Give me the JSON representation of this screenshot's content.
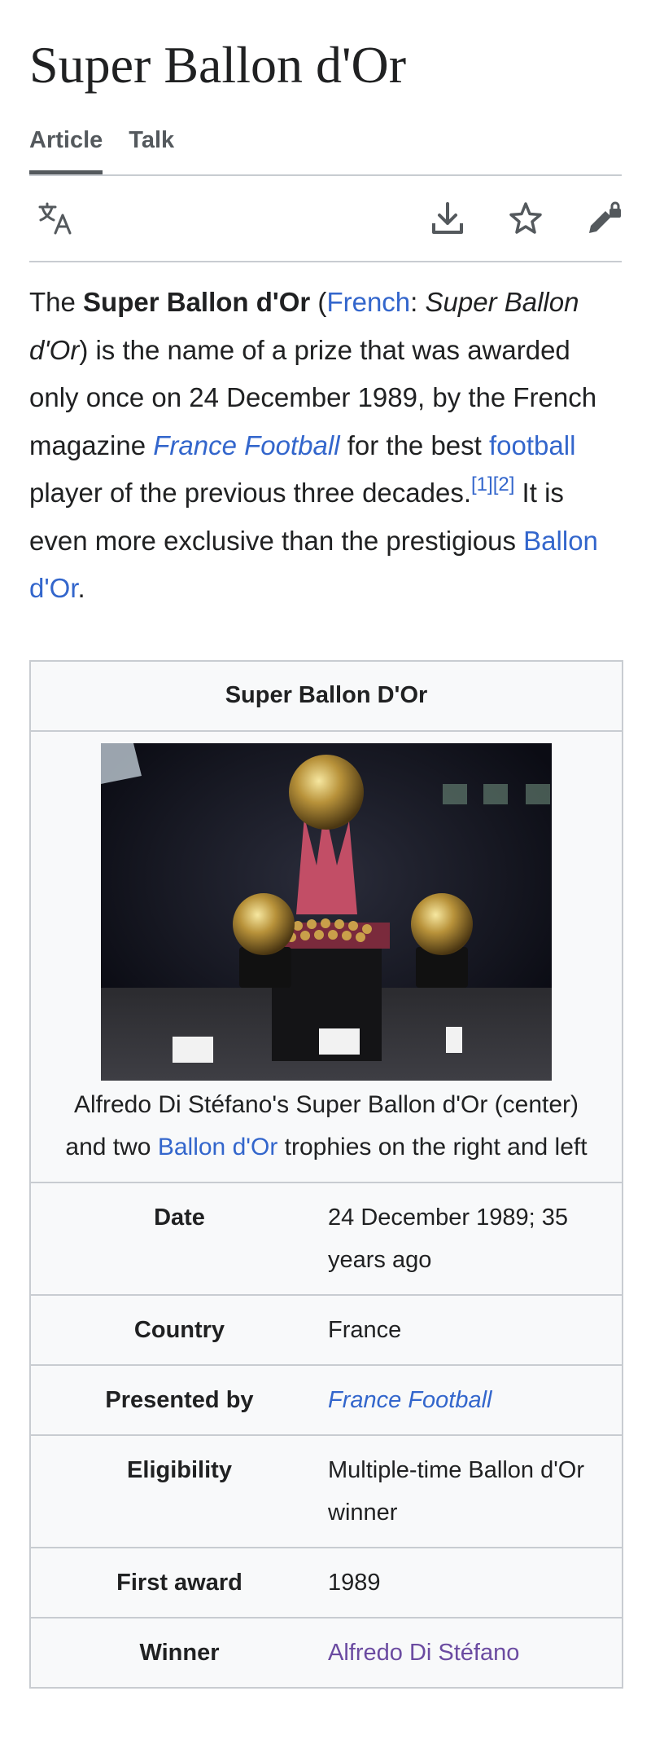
{
  "article": {
    "title": "Super Ballon d'Or",
    "tabs": [
      {
        "label": "Article",
        "active": true
      },
      {
        "label": "Talk",
        "active": false
      }
    ]
  },
  "toolbar": {
    "icons": [
      "translate-icon",
      "download-icon",
      "star-icon",
      "edit-lock-icon"
    ]
  },
  "intro": {
    "p1": "The ",
    "bold_name": "Super Ballon d'Or",
    "p2": " (",
    "lang_link": "French",
    "p3": ": ",
    "italic_name": "Super Ballon d'Or",
    "p4": ") is the name of a prize that was awarded only once on 24 December 1989, by the French magazine ",
    "magazine_link": "France Football",
    "p5": " for the best ",
    "football_link": "football",
    "p6": " player of the previous three decades.",
    "ref1": "[1]",
    "ref2": "[2]",
    "p7": " It is even more exclusive than the prestigious ",
    "ballon_link": "Ballon d'Or",
    "p8": "."
  },
  "infobox": {
    "heading": "Super Ballon D'Or",
    "caption_part1": "Alfredo Di Stéfano's Super Ballon d'Or (center) and two ",
    "caption_link": "Ballon d'Or",
    "caption_part2": " trophies on the right and left",
    "rows": [
      {
        "label": "Date",
        "value": "24 December 1989; 35 years ago"
      },
      {
        "label": "Country",
        "value": "France"
      },
      {
        "label": "Presented by",
        "value": "France Football"
      },
      {
        "label": "Eligibility",
        "value": "Multiple-time Ballon d'Or winner"
      },
      {
        "label": "First award",
        "value": "1989"
      },
      {
        "label": "Winner",
        "value": "Alfredo Di Stéfano"
      }
    ]
  },
  "colors": {
    "link": "#3366cc",
    "visited_link": "#6b4ba1",
    "border": "#c8ccd1",
    "infobox_bg": "#f8f9fa"
  }
}
